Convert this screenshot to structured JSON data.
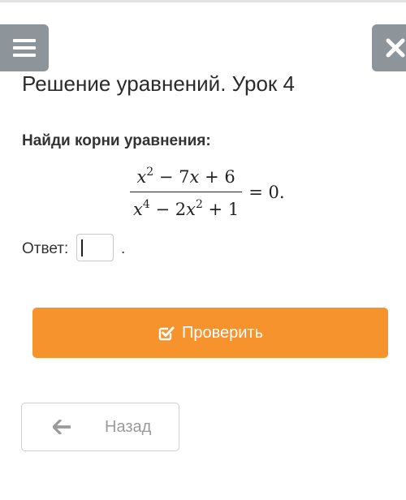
{
  "header": {
    "menu_icon": "menu-icon",
    "close_icon": "close-icon",
    "button_color": "#8d959b"
  },
  "lesson": {
    "title": "Решение уравнений. Урок 4"
  },
  "task": {
    "heading": "Найди корни уравнения:",
    "equation": {
      "numerator": [
        "x",
        "2",
        "− 7",
        "x",
        "+ 6"
      ],
      "denominator": [
        "x",
        "4",
        "− 2",
        "x",
        "2",
        "+ 1"
      ],
      "rhs": "= 0."
    },
    "answer_label": "Ответ:",
    "answer_value": "",
    "answer_suffix": "."
  },
  "actions": {
    "check_label": "Проверить",
    "check_icon": "checkbox-check-icon",
    "check_color": "#f6932d",
    "back_label": "Назад",
    "back_icon": "arrow-left-icon"
  }
}
